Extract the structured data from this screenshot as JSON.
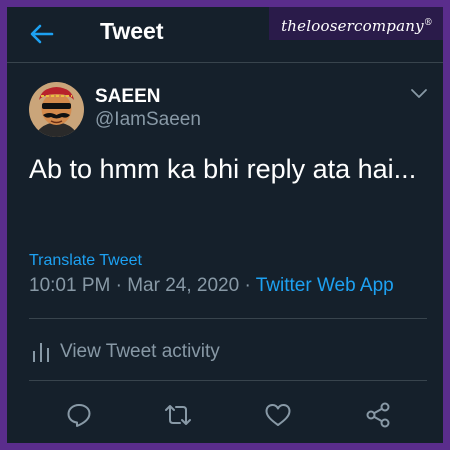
{
  "header": {
    "title": "Tweet",
    "back_icon": "arrow-left-icon"
  },
  "watermark": {
    "text": "theloosercompany",
    "mark": "®"
  },
  "tweet": {
    "author_name": "SAEEN",
    "author_handle": "@IamSaeen",
    "text": "Ab to hmm ka bhi reply ata hai...",
    "translate_label": "Translate Tweet",
    "time": "10:01 PM",
    "date": "Mar 24, 2020",
    "separator": "·",
    "source": "Twitter Web App"
  },
  "activity": {
    "label": "View Tweet activity",
    "icon": "bar-chart-icon"
  },
  "actions": [
    "reply-icon",
    "retweet-icon",
    "like-icon",
    "share-icon"
  ],
  "colors": {
    "background": "#15202b",
    "border": "#5a2d8c",
    "accent": "#1da1f2",
    "secondary_text": "#8899a6",
    "divider": "#38444d"
  }
}
